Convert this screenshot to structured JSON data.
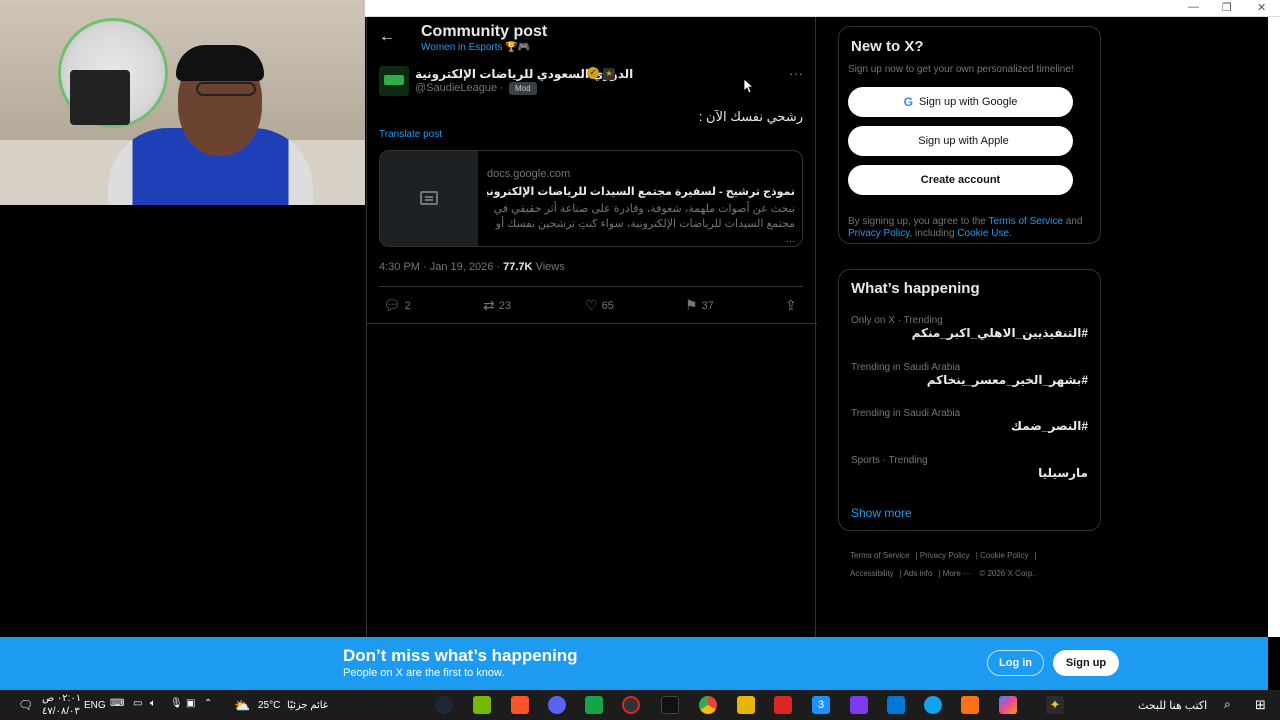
{
  "window": {
    "minimize": "—",
    "restore": "❐",
    "close": "✕"
  },
  "header": {
    "title": "Community post",
    "community": "Women in Esports 🏆🎮"
  },
  "post": {
    "author_name": "الدوري السعودي للرياضات الإلكترونية",
    "handle": "@SaudieLeague ·",
    "mod_label": "Mod",
    "text": "رشحي نفسك الآن :",
    "translate": "Translate post",
    "card": {
      "domain": "docs.google.com",
      "title": "نموذج ترشيح - لسفيرة مجتمع السيدات للرياضات الإلكترونية لموس...",
      "desc": "نبحث عن أصوات ملهمة، شغوفة، وقادرة على صناعة أثر حقيقي في مجتمع السيدات للرياضات الإلكترونية، سواء كنتِ ترشحين نفسك أو ..."
    },
    "time": "4:30 PM · Jan 19, 2026 ·",
    "views_count": "77.7K",
    "views_label": "Views",
    "replies": "2",
    "reposts": "23",
    "likes": "65",
    "bookmarks": "37"
  },
  "signup": {
    "title": "New to X?",
    "subtitle": "Sign up now to get your own personalized timeline!",
    "google": "Sign up with Google",
    "apple": "Sign up with Apple",
    "create": "Create account",
    "terms_pre": "By signing up, you agree to the",
    "terms_link": "Terms of Service",
    "terms_and": "and",
    "privacy_link": "Privacy Policy",
    "terms_including": ", including",
    "cookie_link": "Cookie Use."
  },
  "happening": {
    "title": "What’s happening",
    "trends": [
      {
        "context": "Only on X · Trending",
        "name": "#التنفيذيين_الاهلي_اكبر_منكم"
      },
      {
        "context": "Trending in Saudi Arabia",
        "name": "#بشهر_الخير_معسر_ينخاكم"
      },
      {
        "context": "Trending in Saudi Arabia",
        "name": "#النصر_ضمك"
      },
      {
        "context": "Sports · Trending",
        "name": "مارسيليا"
      }
    ],
    "show_more": "Show more"
  },
  "footer": {
    "terms": "Terms of Service",
    "privacy": "Privacy Policy",
    "cookie": "Cookie Policy",
    "accessibility": "Accessibility",
    "ads": "Ads info",
    "more": "More ···",
    "copyright": "© 2026 X Corp."
  },
  "banner": {
    "title": "Don’t miss what’s happening",
    "subtitle": "People on X are the first to know.",
    "login": "Log in",
    "signup": "Sign up"
  },
  "taskbar": {
    "search_placeholder": "اكتب هنا للبحث",
    "weather_temp": "25°C",
    "weather_text": "غائم جزئيًا",
    "lang": "ENG",
    "time": "٠٢:٠١ ص",
    "date": "٤٧/٠٨/٠٣"
  }
}
